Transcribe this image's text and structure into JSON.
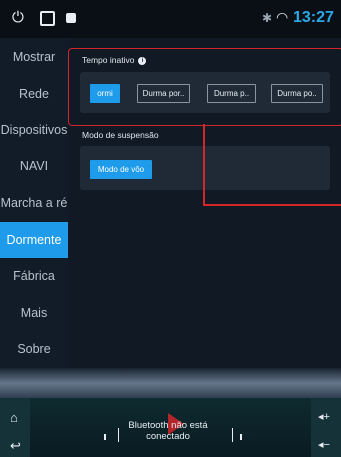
{
  "status_bar": {
    "power_icon": "power-icon",
    "recents_icon": "square-icon",
    "app_icon": "app-icon",
    "bluetooth_icon": "bluetooth-icon",
    "wifi_icon": "wifi-icon",
    "time": "13:27"
  },
  "sidebar": {
    "items": [
      {
        "label": "Mostrar"
      },
      {
        "label": "Rede"
      },
      {
        "label": "Dispositivos"
      },
      {
        "label": "NAVI"
      },
      {
        "label": "Marcha a ré"
      },
      {
        "label": "Dormente"
      },
      {
        "label": "Fábrica"
      },
      {
        "label": "Mais"
      },
      {
        "label": "Sobre"
      }
    ],
    "active_index": 5
  },
  "idle": {
    "title": "Tempo inativo",
    "info_icon": "info-icon",
    "options": [
      "ormi",
      "Durma por..",
      "Durma p..",
      "Durma po.."
    ],
    "selected_index": 0
  },
  "sleep_mode": {
    "title": "Modo de suspensão",
    "options": [
      "Modo de vôo"
    ],
    "selected_index": 0
  },
  "bottom": {
    "home_icon": "home-icon",
    "back_icon": "back-icon",
    "vol_up_icon": "volume-up-icon",
    "vol_down_icon": "volume-down-icon",
    "bluetooth_status": "Bluetooth não está conectado"
  },
  "colors": {
    "accent": "#1e9bea",
    "highlight": "#d2262b",
    "time": "#29a9e8"
  }
}
